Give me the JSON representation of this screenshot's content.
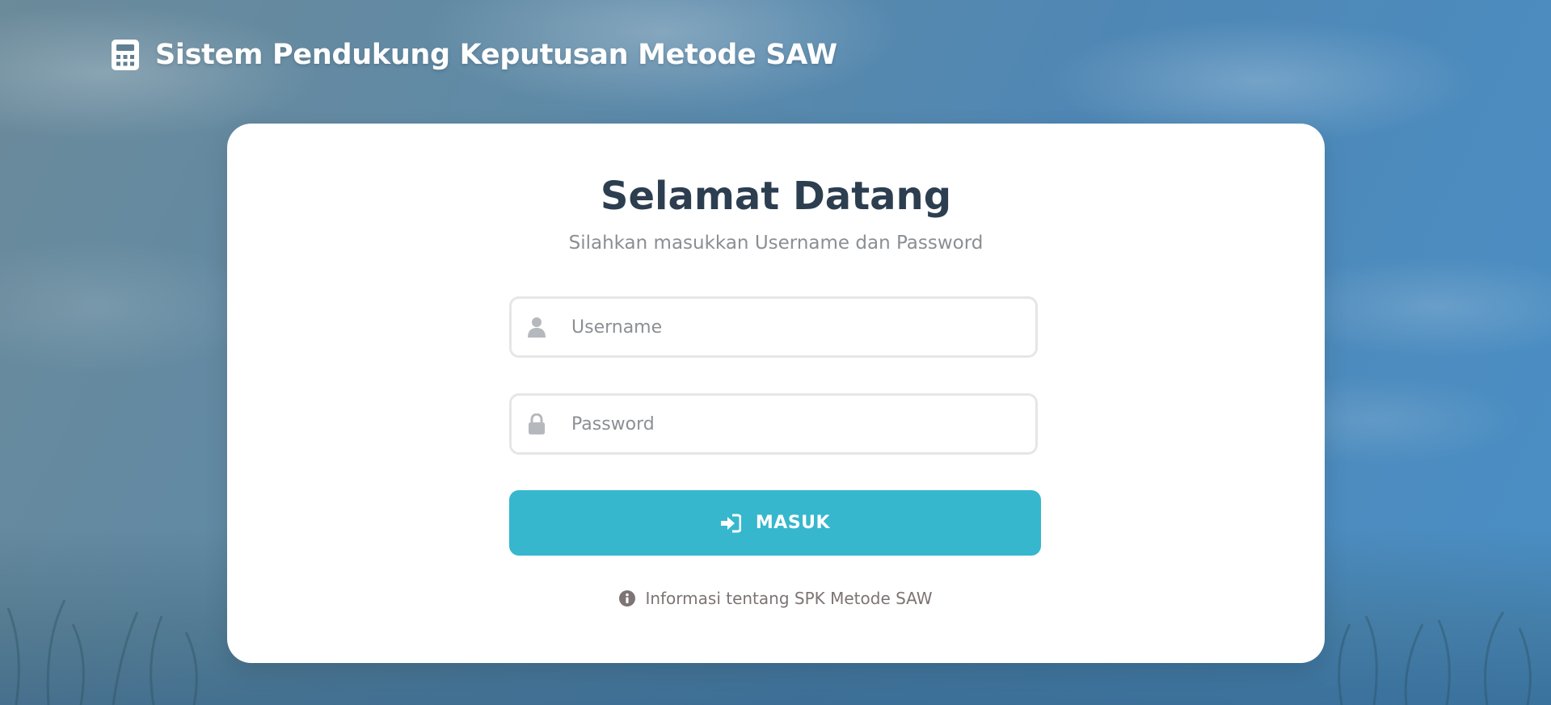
{
  "header": {
    "title": "Sistem Pendukung Keputusan Metode SAW",
    "icon": "calculator-icon"
  },
  "login": {
    "title": "Selamat Datang",
    "subtitle": "Silahkan masukkan Username dan Password",
    "username": {
      "placeholder": "Username",
      "value": "",
      "icon": "user-icon"
    },
    "password": {
      "placeholder": "Password",
      "value": "",
      "icon": "lock-icon"
    },
    "submit": {
      "label": "MASUK",
      "icon": "sign-in-icon"
    },
    "info_link": {
      "label": "Informasi tentang SPK Metode SAW",
      "icon": "info-circle-icon"
    }
  },
  "colors": {
    "accent": "#36b7cd",
    "title_text": "#2c3e50",
    "muted_text": "#8a8f93",
    "link_text": "#7d7474"
  }
}
